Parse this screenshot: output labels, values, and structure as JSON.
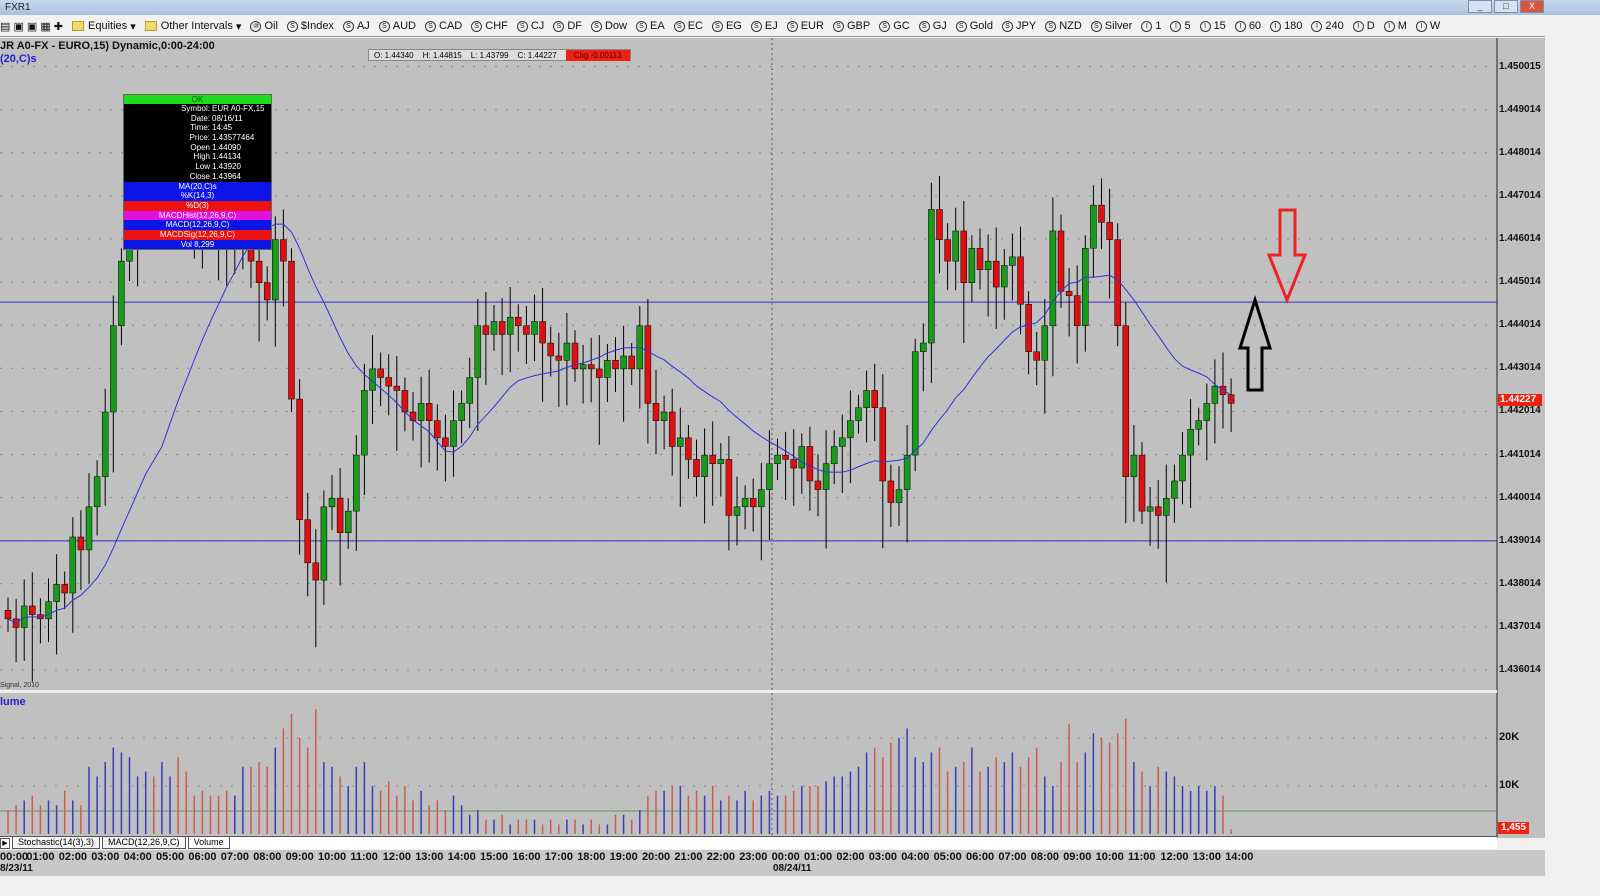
{
  "window": {
    "title": "FXR1",
    "buttons": [
      "_",
      "□",
      "X"
    ]
  },
  "toolbar": {
    "folders": [
      "Equities",
      "Other Intervals"
    ],
    "symbols": [
      {
        "badge": "⑩",
        "label": "Oil"
      },
      {
        "badge": "S",
        "label": "$Index"
      },
      {
        "badge": "S",
        "label": "AJ"
      },
      {
        "badge": "S",
        "label": "AUD"
      },
      {
        "badge": "S",
        "label": "CAD"
      },
      {
        "badge": "S",
        "label": "CHF"
      },
      {
        "badge": "S",
        "label": "CJ"
      },
      {
        "badge": "S",
        "label": "DF"
      },
      {
        "badge": "S",
        "label": "Dow"
      },
      {
        "badge": "S",
        "label": "EA"
      },
      {
        "badge": "S",
        "label": "EC"
      },
      {
        "badge": "S",
        "label": "EG"
      },
      {
        "badge": "S",
        "label": "EJ"
      },
      {
        "badge": "S",
        "label": "EUR"
      },
      {
        "badge": "S",
        "label": "GBP"
      },
      {
        "badge": "S",
        "label": "GC"
      },
      {
        "badge": "S",
        "label": "GJ"
      },
      {
        "badge": "S",
        "label": "Gold"
      },
      {
        "badge": "S",
        "label": "JPY"
      },
      {
        "badge": "S",
        "label": "NZD"
      },
      {
        "badge": "S",
        "label": "Silver"
      },
      {
        "badge": "I",
        "label": "1"
      },
      {
        "badge": "I",
        "label": "5"
      },
      {
        "badge": "I",
        "label": "15"
      },
      {
        "badge": "I",
        "label": "60"
      },
      {
        "badge": "I",
        "label": "180"
      },
      {
        "badge": "I",
        "label": "240"
      },
      {
        "badge": "I",
        "label": "D"
      },
      {
        "badge": "I",
        "label": "M"
      },
      {
        "badge": "I",
        "label": "W"
      }
    ]
  },
  "header": {
    "title": "JR A0-FX - EURO,15) Dynamic,0:00-24:00",
    "ma_label": "​(20,C)s"
  },
  "ohlc": {
    "o": "O: 1.44340",
    "h": "H: 1.44815",
    "l": "L: 1.43799",
    "c": "C: 1.44227",
    "chg": "Chg -0.00113"
  },
  "tooltip": {
    "ok": "OK",
    "rows": [
      [
        "Symbol:",
        "EUR A0-FX,15"
      ],
      [
        "Date:",
        "08/16/11"
      ],
      [
        "Time:",
        "14:45"
      ],
      [
        "Price:",
        "1.43577464"
      ],
      [
        "Open",
        "1.44090"
      ],
      [
        "High",
        "1.44134"
      ],
      [
        "Low",
        "1.43920"
      ],
      [
        "Close",
        "1.43964"
      ]
    ],
    "bands": [
      {
        "label": "MA(20,C)s",
        "color": "#0a14e6"
      },
      {
        "label": "%K(14,3)",
        "color": "#0a14e6"
      },
      {
        "label": "%D(3)",
        "color": "#ee1111"
      },
      {
        "label": "MACDHist(12,26,9,C)",
        "color": "#e010e0"
      },
      {
        "label": "MACD(12,26,9,C)",
        "color": "#0a14e6"
      },
      {
        "label": "MACDSig(12,26,9,C)",
        "color": "#ee1111"
      },
      {
        "label": "Vol 8,299",
        "color": "#0a14e6"
      }
    ]
  },
  "signal_text": "Signal, 2010",
  "price_tag": "1.44227",
  "volume": {
    "label": "lume",
    "tag": "1,455",
    "axis": [
      "20K",
      "10K"
    ]
  },
  "tabs": [
    "Stochastic(14(3),3)",
    "MACD(12,26,9,C)",
    "Volume"
  ],
  "dates": [
    "8/23/11",
    "08/24/11"
  ],
  "colors": {
    "up": "#1a9a1a",
    "down": "#dd1111",
    "ma": "#3030e0",
    "hline": "#3030c8",
    "vol_up": "#3a3ac0",
    "vol_down": "#d05a50",
    "arrow_up": "#000000",
    "arrow_down": "#ee2222"
  },
  "chart_data": {
    "type": "candlestick",
    "interval": "15 min",
    "y_range": [
      1.4355,
      1.4505
    ],
    "y_ticks": [
      "1.436014",
      "1.437014",
      "1.438014",
      "1.439014",
      "1.440014",
      "1.441014",
      "1.442014",
      "1.443014",
      "1.444014",
      "1.445014",
      "1.446014",
      "1.447014",
      "1.448014",
      "1.449014",
      "1.450015"
    ],
    "x_ticks": [
      "00:00",
      "01:00",
      "02:00",
      "03:00",
      "04:00",
      "05:00",
      "06:00",
      "07:00",
      "08:00",
      "09:00",
      "10:00",
      "11:00",
      "12:00",
      "13:00",
      "14:00",
      "15:00",
      "16:00",
      "17:00",
      "18:00",
      "19:00",
      "20:00",
      "21:00",
      "22:00",
      "23:00",
      "00:00",
      "01:00",
      "02:00",
      "03:00",
      "04:00",
      "05:00",
      "06:00",
      "07:00",
      "08:00",
      "09:00",
      "10:00",
      "11:00",
      "12:00",
      "13:00",
      "14:00"
    ],
    "horizontal_lines": [
      1.44455,
      1.43901
    ],
    "ma_period": 20,
    "first_open": 1.4374,
    "closes": [
      1.4372,
      1.437,
      1.4375,
      1.4373,
      1.4372,
      1.4376,
      1.438,
      1.4378,
      1.4391,
      1.4388,
      1.4398,
      1.4405,
      1.442,
      1.444,
      1.4455,
      1.446,
      1.447,
      1.4478,
      1.4466,
      1.4472,
      1.448,
      1.4475,
      1.447,
      1.4468,
      1.4465,
      1.4462,
      1.446,
      1.4458,
      1.446,
      1.4462,
      1.4455,
      1.445,
      1.4446,
      1.446,
      1.4455,
      1.4423,
      1.4395,
      1.4385,
      1.4381,
      1.4398,
      1.44,
      1.4392,
      1.4397,
      1.441,
      1.4425,
      1.443,
      1.4428,
      1.4426,
      1.4425,
      1.442,
      1.4418,
      1.4422,
      1.4418,
      1.4414,
      1.4412,
      1.4418,
      1.4422,
      1.4428,
      1.444,
      1.4438,
      1.4441,
      1.4438,
      1.4442,
      1.444,
      1.4438,
      1.4441,
      1.4436,
      1.4433,
      1.4432,
      1.4436,
      1.443,
      1.4431,
      1.443,
      1.4428,
      1.4432,
      1.443,
      1.4433,
      1.443,
      1.444,
      1.4422,
      1.4418,
      1.442,
      1.4412,
      1.4414,
      1.4409,
      1.4405,
      1.441,
      1.4408,
      1.4409,
      1.4396,
      1.4398,
      1.44,
      1.4398,
      1.4402,
      1.4408,
      1.441,
      1.4409,
      1.4407,
      1.4412,
      1.4404,
      1.4402,
      1.4408,
      1.4412,
      1.4414,
      1.4418,
      1.4421,
      1.4425,
      1.4421,
      1.4404,
      1.4399,
      1.4402,
      1.441,
      1.4434,
      1.4436,
      1.4467,
      1.446,
      1.4455,
      1.4462,
      1.445,
      1.4458,
      1.4453,
      1.4455,
      1.4449,
      1.4454,
      1.4456,
      1.4445,
      1.4434,
      1.4432,
      1.444,
      1.4462,
      1.4448,
      1.4447,
      1.444,
      1.4458,
      1.4468,
      1.4464,
      1.446,
      1.444,
      1.4405,
      1.441,
      1.4397,
      1.4398,
      1.4396,
      1.44,
      1.4404,
      1.441,
      1.4416,
      1.4418,
      1.4422,
      1.4426,
      1.4424,
      1.4422
    ],
    "volumes_k": [
      5,
      6,
      7,
      8,
      6,
      7,
      6,
      9,
      7,
      6,
      14,
      12,
      15,
      18,
      17,
      16,
      12,
      13,
      12,
      15,
      12,
      16,
      13,
      8,
      9,
      8,
      8,
      9,
      8,
      14,
      14,
      15,
      14,
      18,
      22,
      25,
      20,
      18,
      26,
      15,
      14,
      12,
      10,
      14,
      15,
      10,
      9,
      11,
      8,
      10,
      7,
      9,
      6,
      7,
      5,
      8,
      6,
      4,
      5,
      3,
      3,
      4,
      2,
      3,
      3,
      3,
      2,
      3,
      2,
      3,
      3,
      2,
      3,
      2,
      2,
      4,
      4,
      3,
      5,
      8,
      9,
      9,
      10,
      10,
      8,
      9,
      8,
      10,
      7,
      8,
      7,
      9,
      7,
      8,
      9,
      8,
      8,
      9,
      10,
      10,
      10,
      11,
      12,
      12,
      13,
      14,
      17,
      18,
      16,
      19,
      20,
      22,
      16,
      15,
      17,
      18,
      13,
      14,
      15,
      18,
      13,
      14,
      16,
      15,
      17,
      14,
      16,
      18,
      12,
      10,
      15,
      23,
      15,
      17,
      21,
      20,
      19,
      21,
      24,
      15,
      13,
      10,
      14,
      13,
      12,
      10,
      9,
      10,
      9,
      10,
      8,
      1
    ]
  }
}
